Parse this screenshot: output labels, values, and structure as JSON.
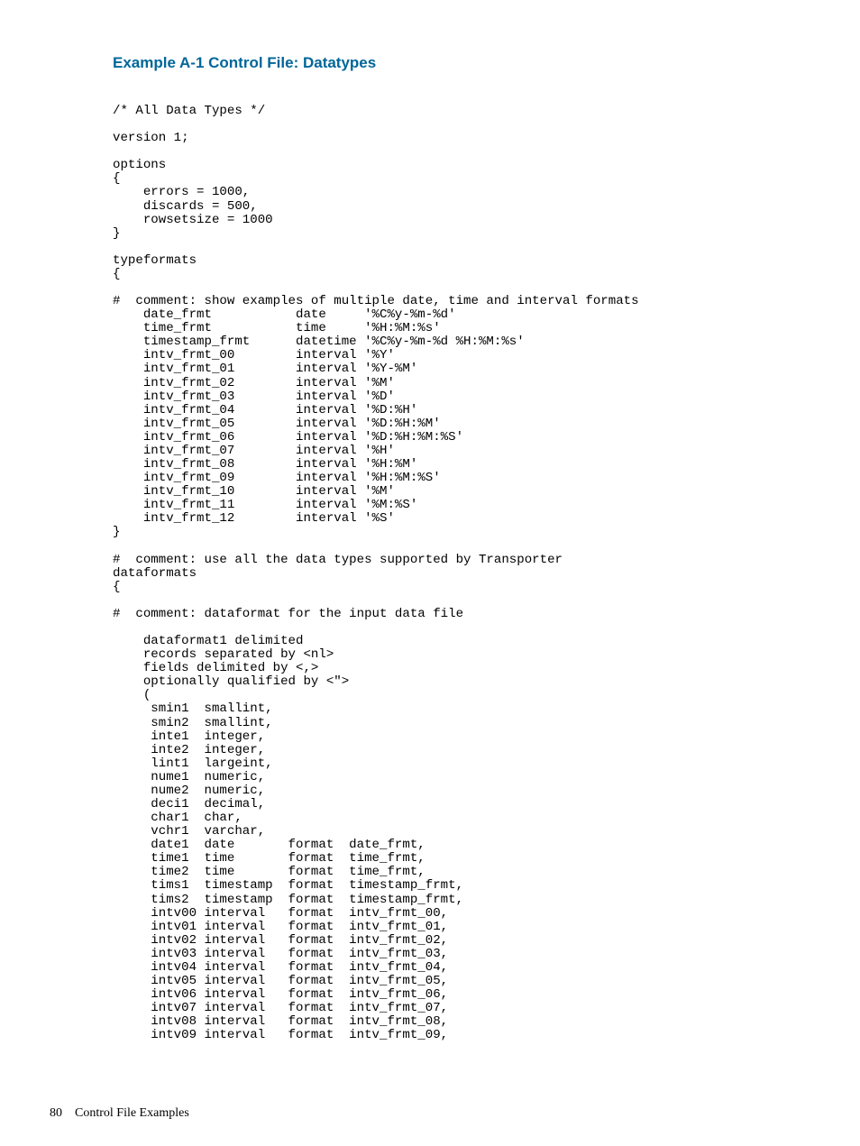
{
  "heading": "Example A-1 Control File: Datatypes",
  "code": "/* All Data Types */\n\nversion 1;\n\noptions\n{\n    errors = 1000,\n    discards = 500,\n    rowsetsize = 1000\n}\n\ntypeformats\n{\n\n#  comment: show examples of multiple date, time and interval formats\n    date_frmt           date     '%C%y-%m-%d'\n    time_frmt           time     '%H:%M:%s'\n    timestamp_frmt      datetime '%C%y-%m-%d %H:%M:%s'\n    intv_frmt_00        interval '%Y'\n    intv_frmt_01        interval '%Y-%M'\n    intv_frmt_02        interval '%M'\n    intv_frmt_03        interval '%D'\n    intv_frmt_04        interval '%D:%H'\n    intv_frmt_05        interval '%D:%H:%M'\n    intv_frmt_06        interval '%D:%H:%M:%S'\n    intv_frmt_07        interval '%H'\n    intv_frmt_08        interval '%H:%M'\n    intv_frmt_09        interval '%H:%M:%S'\n    intv_frmt_10        interval '%M'\n    intv_frmt_11        interval '%M:%S'\n    intv_frmt_12        interval '%S'\n}\n\n#  comment: use all the data types supported by Transporter\ndataformats\n{\n\n#  comment: dataformat for the input data file\n\n    dataformat1 delimited\n    records separated by <nl>\n    fields delimited by <,>\n    optionally qualified by <\">\n    (\n     smin1  smallint,\n     smin2  smallint,\n     inte1  integer,\n     inte2  integer,\n     lint1  largeint,\n     nume1  numeric,\n     nume2  numeric,\n     deci1  decimal,\n     char1  char,\n     vchr1  varchar,\n     date1  date       format  date_frmt,\n     time1  time       format  time_frmt,\n     time2  time       format  time_frmt,\n     tims1  timestamp  format  timestamp_frmt,\n     tims2  timestamp  format  timestamp_frmt,\n     intv00 interval   format  intv_frmt_00,\n     intv01 interval   format  intv_frmt_01,\n     intv02 interval   format  intv_frmt_02,\n     intv03 interval   format  intv_frmt_03,\n     intv04 interval   format  intv_frmt_04,\n     intv05 interval   format  intv_frmt_05,\n     intv06 interval   format  intv_frmt_06,\n     intv07 interval   format  intv_frmt_07,\n     intv08 interval   format  intv_frmt_08,\n     intv09 interval   format  intv_frmt_09,",
  "footer_page_number": "80",
  "footer_title": "Control File Examples"
}
